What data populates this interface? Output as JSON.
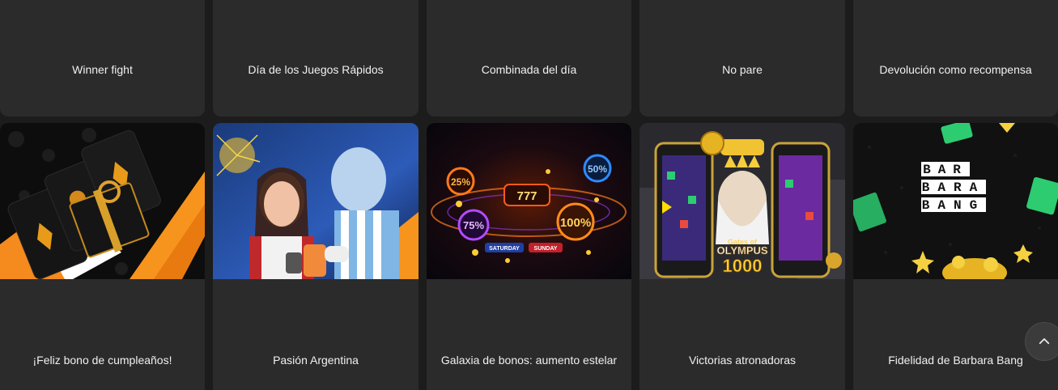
{
  "promotions_row1": [
    {
      "title": "Winner fight"
    },
    {
      "title": "Día de los Juegos Rápidos"
    },
    {
      "title": "Combinada del día"
    },
    {
      "title": "No pare"
    },
    {
      "title": "Devolución como recompensa"
    }
  ],
  "promotions_row2": [
    {
      "title": "¡Feliz bono de cumpleaños!",
      "image": "birthday-gift-icon"
    },
    {
      "title": "Pasión Argentina",
      "image": "argentina-fans-icon"
    },
    {
      "title": "Galaxia de bonos: aumento estelar",
      "image": "bonus-galaxy-icon",
      "badges": [
        "25%",
        "50%",
        "75%",
        "100%",
        "777",
        "SATURDAY",
        "SUNDAY"
      ]
    },
    {
      "title": "Victorias atronadoras",
      "image": "gates-of-olympus-icon",
      "game_lines": [
        "Gates of",
        "OLYMPUS",
        "1000"
      ]
    },
    {
      "title": "Fidelidad de Barbara Bang",
      "image": "barbara-bang-logo",
      "logo_lines": [
        "BAR",
        "BARA",
        "BANG"
      ]
    }
  ],
  "colors": {
    "card": "#2b2b2b",
    "background": "#1c1c1c",
    "text": "#f0f0f0",
    "accent_orange": "#f7941d"
  }
}
